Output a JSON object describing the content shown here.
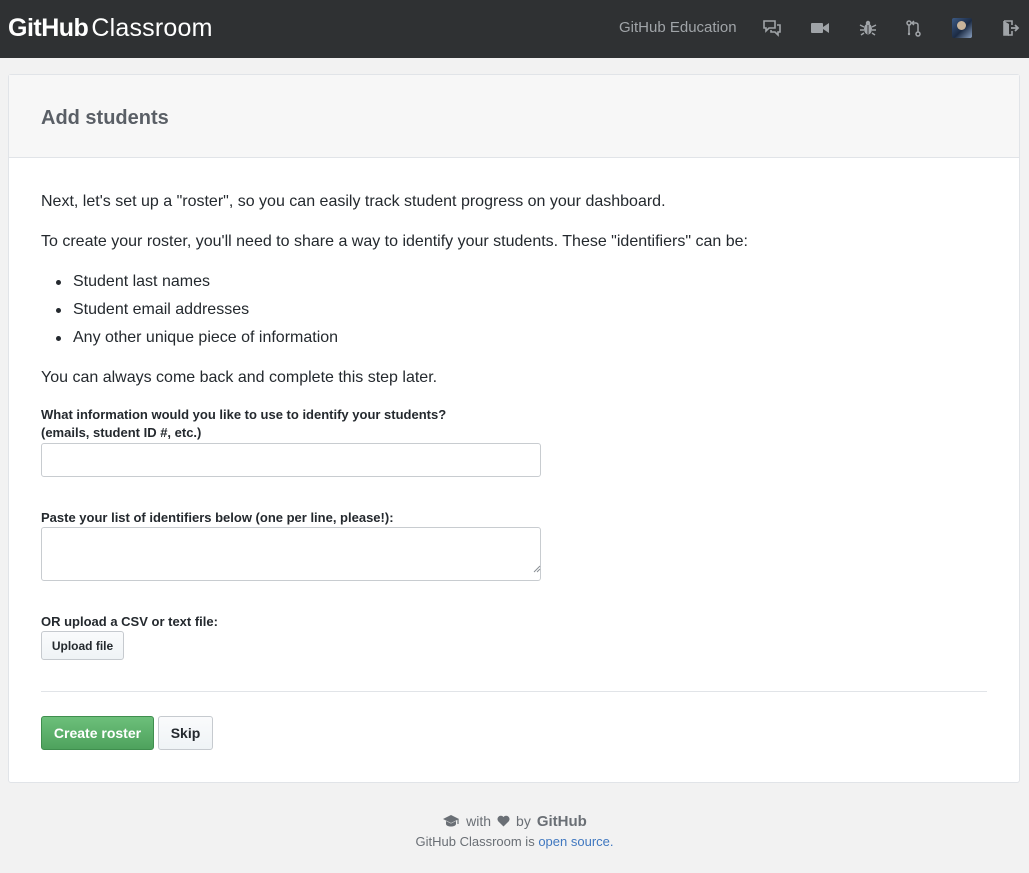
{
  "nav": {
    "brand_bold": "GitHub",
    "brand_light": "Classroom",
    "education_link": "GitHub Education",
    "icons": [
      "chat-icon",
      "video-icon",
      "bug-icon",
      "pull-request-icon",
      "avatar",
      "sign-out-icon"
    ]
  },
  "card": {
    "title": "Add students",
    "intro": "Next, let's set up a \"roster\", so you can easily track student progress on your dashboard.",
    "identifiers_text": "To create your roster, you'll need to share a way to identify your students. These \"identifiers\" can be:",
    "bullets": [
      "Student last names",
      "Student email addresses",
      "Any other unique piece of information"
    ],
    "later_text": "You can always come back and complete this step later."
  },
  "form": {
    "identifier_label_line1": "What information would you like to use to identify your students?",
    "identifier_label_line2": "(emails, student ID #, etc.)",
    "identifier_value": "",
    "list_label": "Paste your list of identifiers below (one per line, please!):",
    "list_value": "",
    "upload_label": "OR upload a CSV or text file:",
    "upload_button": "Upload file",
    "create_button": "Create roster",
    "skip_button": "Skip"
  },
  "footer": {
    "with": "with",
    "by": "by",
    "github": "GitHub",
    "line2_prefix": "GitHub Classroom is",
    "open_source_link": "open source."
  },
  "colors": {
    "topbar": "#2f3133",
    "create_button": "#5aad69",
    "link": "#4078c0"
  }
}
